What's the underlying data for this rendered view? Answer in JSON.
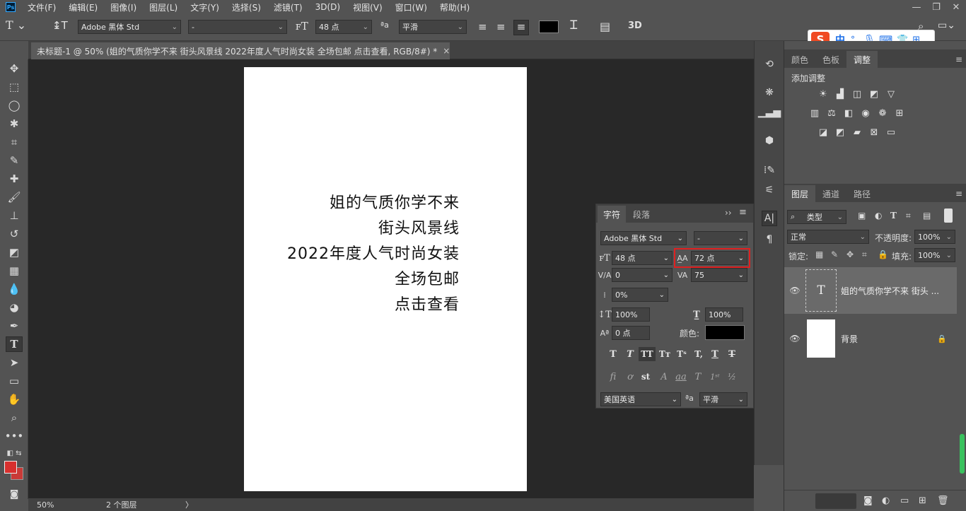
{
  "menubar": {
    "logo": "Ps",
    "items": [
      "文件(F)",
      "编辑(E)",
      "图像(I)",
      "图层(L)",
      "文字(Y)",
      "选择(S)",
      "滤镜(T)",
      "3D(D)",
      "视图(V)",
      "窗口(W)",
      "帮助(H)"
    ]
  },
  "options": {
    "font_family": "Adobe 黑体 Std",
    "font_style": "-",
    "font_size": "48 点",
    "aa_label": "ªa",
    "antialias": "平滑",
    "color_hex": "#000000"
  },
  "ime": {
    "label": "中",
    "punct": "°,"
  },
  "document": {
    "tab_title": "未标题-1 @ 50% (姐的气质你学不来 街头风景线 2022年度人气时尚女装 全场包邮 点击查看, RGB/8#) *",
    "close": "×",
    "lines": [
      "姐的气质你学不来",
      "街头风景线",
      "2022年度人气时尚女装",
      "全场包邮",
      "点击查看"
    ],
    "page_color": "#ffffff"
  },
  "status": {
    "zoom": "50%",
    "info": "2 个图层",
    "arrow": "〉"
  },
  "right": {
    "tabs_top": [
      {
        "label": "颜色"
      },
      {
        "label": "色板"
      },
      {
        "label": "调整"
      }
    ],
    "adjust_title": "添加调整",
    "tabs_layers": [
      {
        "label": "图层"
      },
      {
        "label": "通道"
      },
      {
        "label": "路径"
      }
    ],
    "filter_kind": "类型",
    "blend_mode": "正常",
    "opacity_label": "不透明度:",
    "opacity_value": "100%",
    "lock_label": "锁定:",
    "fill_label": "填充:",
    "fill_value": "100%",
    "layers": [
      {
        "name": "姐的气质你学不来 街头 ...",
        "thumb": "T"
      },
      {
        "name": "背景",
        "thumb": ""
      }
    ]
  },
  "character": {
    "tab_char": "字符",
    "tab_para": "段落",
    "font_family": "Adobe 黑体 Std",
    "font_style": "-",
    "size": "48 点",
    "leading": "72 点",
    "kerning": "0",
    "tracking": "75",
    "scale_pct": "0%",
    "vscale": "100%",
    "hscale": "100%",
    "baseline": "0 点",
    "color_label": "颜色:",
    "color_hex": "#000000",
    "language": "美国英语",
    "aa_label": "ªa",
    "antialias": "平滑",
    "highlight_color": "#e02020"
  }
}
